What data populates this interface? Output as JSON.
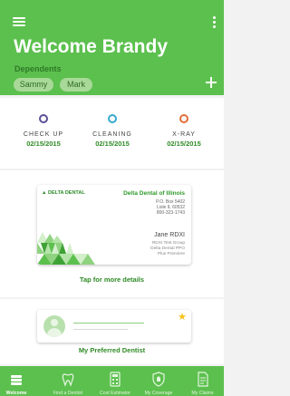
{
  "header": {
    "title": "Welcome Brandy",
    "dependents_label": "Dependents",
    "dependents": [
      "Sammy",
      "Mark"
    ]
  },
  "appointments": [
    {
      "name": "CHECK UP",
      "date": "02/15/2015",
      "color": "#5b4f97"
    },
    {
      "name": "CLEANING",
      "date": "02/15/2015",
      "color": "#38a9cf"
    },
    {
      "name": "X-RAY",
      "date": "02/15/2015",
      "color": "#e0703a"
    }
  ],
  "insurance_card": {
    "logo": "DELTA DENTAL",
    "plan_name": "Delta Dental of Illinois",
    "address": [
      "P.O. Box 5402",
      "Lisle IL 60532",
      "800-323-1743"
    ],
    "member_name": "Jane RDXI",
    "member_info": [
      "RDXI Test Group",
      "Delta Dental PPO",
      "Plus Premiere"
    ],
    "link": "Tap for more details"
  },
  "dentist": {
    "label": "My Preferred Dentist",
    "star_icon": "star-icon"
  },
  "bottom_nav": [
    {
      "label": "Welcome",
      "icon": "home-icon",
      "active": true
    },
    {
      "label": "Find a Dentist",
      "icon": "tooth-icon",
      "active": false
    },
    {
      "label": "Cost Estimator",
      "icon": "calculator-icon",
      "active": false
    },
    {
      "label": "My Coverage",
      "icon": "shield-icon",
      "active": false
    },
    {
      "label": "My Claims",
      "icon": "document-icon",
      "active": false
    }
  ],
  "colors": {
    "brand_green": "#5cc04e",
    "accent_green": "#2f8a26",
    "star": "#f6c21b"
  }
}
